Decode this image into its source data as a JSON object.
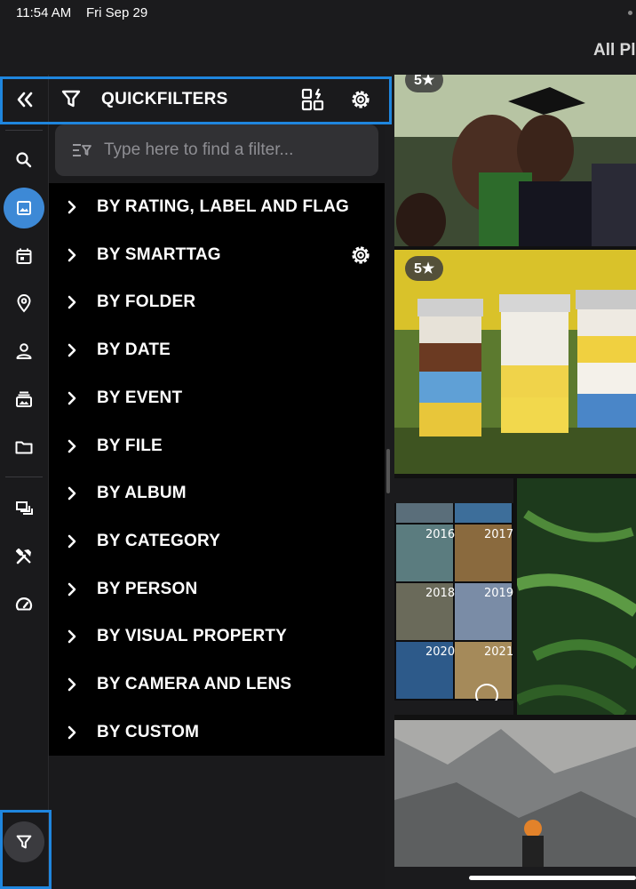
{
  "status_bar": {
    "time": "11:54 AM",
    "date": "Fri Sep 29"
  },
  "top_title": "All Pl",
  "panel": {
    "title": "QUICKFILTERS",
    "search_placeholder": "Type here to find a filter...",
    "items": [
      {
        "label": "BY RATING, LABEL AND FLAG"
      },
      {
        "label": "BY SMARTTAG",
        "has_settings": true
      },
      {
        "label": "BY FOLDER"
      },
      {
        "label": "BY DATE"
      },
      {
        "label": "BY EVENT"
      },
      {
        "label": "BY FILE"
      },
      {
        "label": "BY ALBUM"
      },
      {
        "label": "BY CATEGORY"
      },
      {
        "label": "BY PERSON"
      },
      {
        "label": "BY VISUAL PROPERTY"
      },
      {
        "label": "BY CAMERA AND LENS"
      },
      {
        "label": "BY CUSTOM"
      }
    ]
  },
  "rail": {
    "icons": [
      "search-icon",
      "photos-icon",
      "calendar-icon",
      "map-pin-icon",
      "person-icon",
      "album-icon",
      "folder-icon",
      "collections-icon",
      "tools-icon",
      "dashboard-icon"
    ],
    "active": "photos-icon"
  },
  "photos": {
    "badges": [
      "5★",
      "5★"
    ],
    "years": [
      "2016",
      "2017",
      "2018",
      "2019",
      "2020",
      "2021"
    ]
  },
  "colors": {
    "accent": "#3d89d6",
    "highlight": "#1f86de",
    "background": "#1a1a1c",
    "list_bg": "#000000"
  }
}
